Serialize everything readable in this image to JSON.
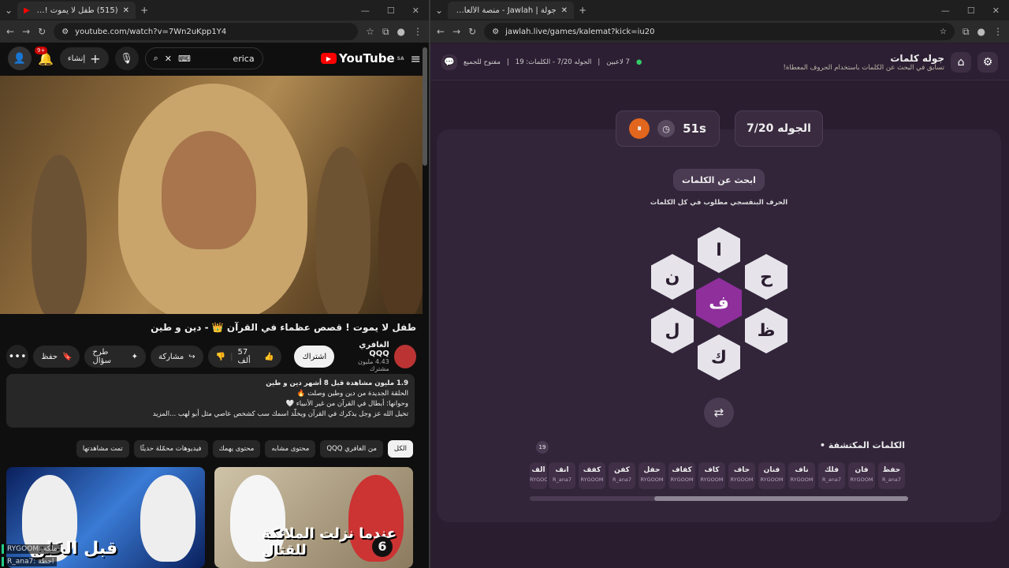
{
  "left_browser": {
    "tab_title": "(515) طفل لا يموت ! قصص",
    "url": "youtube.com/watch?v=7Wn2uKpp1Y4",
    "youtube": {
      "logo": "YouTube",
      "region": "SA",
      "search_value": "erica",
      "create_label": "إنشاء",
      "notif_badge": "9+",
      "video_title": "طفل لا يموت ! قصص عظماء في القرآن 👑 - دين و طين",
      "channel_name": "الغافري QQQ",
      "subscribers": "4.43 مليون مشترك",
      "subscribe_label": "اشتراك",
      "like_count": "57 ألف",
      "share_label": "مشاركة",
      "ask_label": "طرح سؤال",
      "save_label": "حفظ",
      "desc_line1": "1.9 مليون مشاهدة  قبل 8 أشهر  دين و طين",
      "desc_line2": "الحلقة الجديدة من دين وطين وصلت 🔥",
      "desc_line3": "وحوانها: أبطال في القرآن من غير الأنبياء 🤍",
      "desc_line4": "تخيل الله عز وجل يذكرك في القرآن ويخلّد اسمك سب كشخص عاصي مثل أبو لهب ...المزيد",
      "chips": [
        "الكل",
        "من الغافري QQQ",
        "محتوى مشابه",
        "محتوى يهمك",
        "فيديوهات محمّلة حديثًا",
        "تمت مشاهدتها"
      ],
      "thumb1_caption": "قبل الخَلق",
      "thumb2_caption": "عندما نزلت الملائكة للقتال",
      "thumb2_number": "6",
      "overlay1": "RYGOOM: ملكة",
      "overlay2": "R_ana7: احطة"
    }
  },
  "right_browser": {
    "tab_title": "جولة | Jawlah - منصة الألعاب الذ",
    "url": "jawlah.live/games/kalemat?kick=iu20",
    "game": {
      "title": "جوله كلمات",
      "subtitle": "تسابق في البحث عن الكلمات باستخدام الحروف المعطاة!",
      "players": "7 لاعبين",
      "round_info": "الجوله 7/20 - الكلمات: 19",
      "open_label": "مفتوح للجميع",
      "round_card": "الجوله 7/20",
      "timer": "51s",
      "find_words_label": "ابحث عن الكلمات",
      "hint": "الحرف البنفسجي مطلوب في كل الكلمات",
      "center_letter": "ف",
      "letters": [
        "ا",
        "ح",
        "ظ",
        "ك",
        "ل",
        "ن"
      ],
      "found_title": "• الكلمات المكتشفة",
      "found_count": "19",
      "words": [
        {
          "w": "حفظ",
          "u": "R_ana7"
        },
        {
          "w": "فان",
          "u": "RYGOOM"
        },
        {
          "w": "فلك",
          "u": "R_ana7"
        },
        {
          "w": "ناف",
          "u": "RYGOOM"
        },
        {
          "w": "فنان",
          "u": "RYGOOM"
        },
        {
          "w": "حاف",
          "u": "RYGOOM"
        },
        {
          "w": "كاف",
          "u": "RYGOOM"
        },
        {
          "w": "كفاف",
          "u": "RYGOOM"
        },
        {
          "w": "حفل",
          "u": "RYGOOM"
        },
        {
          "w": "كفن",
          "u": "R_ana7"
        },
        {
          "w": "كفف",
          "u": "RYGOOM"
        },
        {
          "w": "انف",
          "u": "R_ana7"
        },
        {
          "w": "الف",
          "u": "RYGOOM"
        }
      ]
    }
  },
  "colors": {
    "accent_purple": "#8e2f9c",
    "timer_orange": "#e2661d",
    "yt_red": "#ff0000"
  }
}
